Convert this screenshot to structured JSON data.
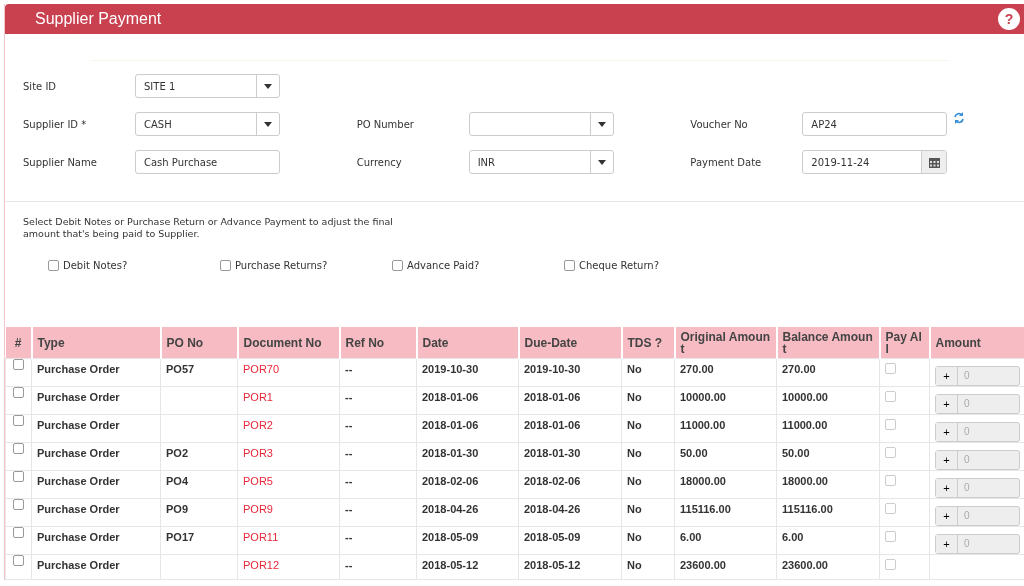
{
  "header": {
    "title": "Supplier Payment",
    "help": "?"
  },
  "form_rows": [
    [
      {
        "label": "Site ID",
        "kind": "select",
        "value": "SITE 1"
      }
    ],
    [
      {
        "label": "Supplier ID *",
        "kind": "select",
        "value": "CASH"
      },
      {
        "label": "PO Number",
        "kind": "select"
      },
      {
        "label": "Voucher No",
        "kind": "text",
        "value": "AP24",
        "refresh": true
      }
    ],
    [
      {
        "label": "Supplier Name",
        "kind": "text",
        "value": "Cash Purchase"
      },
      {
        "label": "Currency",
        "kind": "select",
        "value": "INR"
      },
      {
        "label": "Payment Date",
        "kind": "date",
        "value": "2019-11-24"
      }
    ]
  ],
  "note": "Select Debit Notes or Purchase Return or Advance Payment to adjust the final amount that's being paid to Supplier.",
  "options": [
    {
      "label": "Debit Notes?",
      "checked": false
    },
    {
      "label": "Purchase Returns?",
      "checked": false
    },
    {
      "label": "Advance Paid?",
      "checked": false
    },
    {
      "label": "Cheque Return?",
      "checked": false
    }
  ],
  "table": {
    "columns": [
      "#",
      "Type",
      "PO No",
      "Document No",
      "Ref No",
      "Date",
      "Due-Date",
      "TDS ?",
      "Original Amount",
      "Balance Amount",
      "Pay All",
      "Amount"
    ],
    "rows": [
      {
        "checked": false,
        "type": "Purchase Order",
        "po_no": "PO57",
        "document_no": "POR70",
        "ref_no": "--",
        "date": "2019-10-30",
        "due_date": "2019-10-30",
        "tds": "No",
        "original_amount": "270.00",
        "balance_amount": "270.00",
        "pay_all": false,
        "amount_button": "+",
        "amount": "0"
      },
      {
        "checked": false,
        "type": "Purchase Order",
        "document_no": "POR1",
        "ref_no": "--",
        "date": "2018-01-06",
        "due_date": "2018-01-06",
        "tds": "No",
        "original_amount": "10000.00",
        "balance_amount": "10000.00",
        "pay_all": false,
        "amount_button": "+",
        "amount": "0"
      },
      {
        "checked": false,
        "type": "Purchase Order",
        "document_no": "POR2",
        "ref_no": "--",
        "date": "2018-01-06",
        "due_date": "2018-01-06",
        "tds": "No",
        "original_amount": "11000.00",
        "balance_amount": "11000.00",
        "pay_all": false,
        "amount_button": "+",
        "amount": "0"
      },
      {
        "checked": false,
        "type": "Purchase Order",
        "po_no": "PO2",
        "document_no": "POR3",
        "ref_no": "--",
        "date": "2018-01-30",
        "due_date": "2018-01-30",
        "tds": "No",
        "original_amount": "50.00",
        "balance_amount": "50.00",
        "pay_all": false,
        "amount_button": "+",
        "amount": "0"
      },
      {
        "checked": false,
        "type": "Purchase Order",
        "po_no": "PO4",
        "document_no": "POR5",
        "ref_no": "--",
        "date": "2018-02-06",
        "due_date": "2018-02-06",
        "tds": "No",
        "original_amount": "18000.00",
        "balance_amount": "18000.00",
        "pay_all": false,
        "amount_button": "+",
        "amount": "0"
      },
      {
        "checked": false,
        "type": "Purchase Order",
        "po_no": "PO9",
        "document_no": "POR9",
        "ref_no": "--",
        "date": "2018-04-26",
        "due_date": "2018-04-26",
        "tds": "No",
        "original_amount": "115116.00",
        "balance_amount": "115116.00",
        "pay_all": false,
        "amount_button": "+",
        "amount": "0"
      },
      {
        "checked": false,
        "type": "Purchase Order",
        "po_no": "PO17",
        "document_no": "POR11",
        "ref_no": "--",
        "date": "2018-05-09",
        "due_date": "2018-05-09",
        "tds": "No",
        "original_amount": "6.00",
        "balance_amount": "6.00",
        "pay_all": false,
        "amount_button": "+",
        "amount": "0"
      },
      {
        "checked": false,
        "type": "Purchase Order",
        "document_no": "POR12",
        "ref_no": "--",
        "date": "2018-05-12",
        "due_date": "2018-05-12",
        "tds": "No",
        "original_amount": "23600.00",
        "balance_amount": "23600.00",
        "pay_all": false
      }
    ]
  }
}
